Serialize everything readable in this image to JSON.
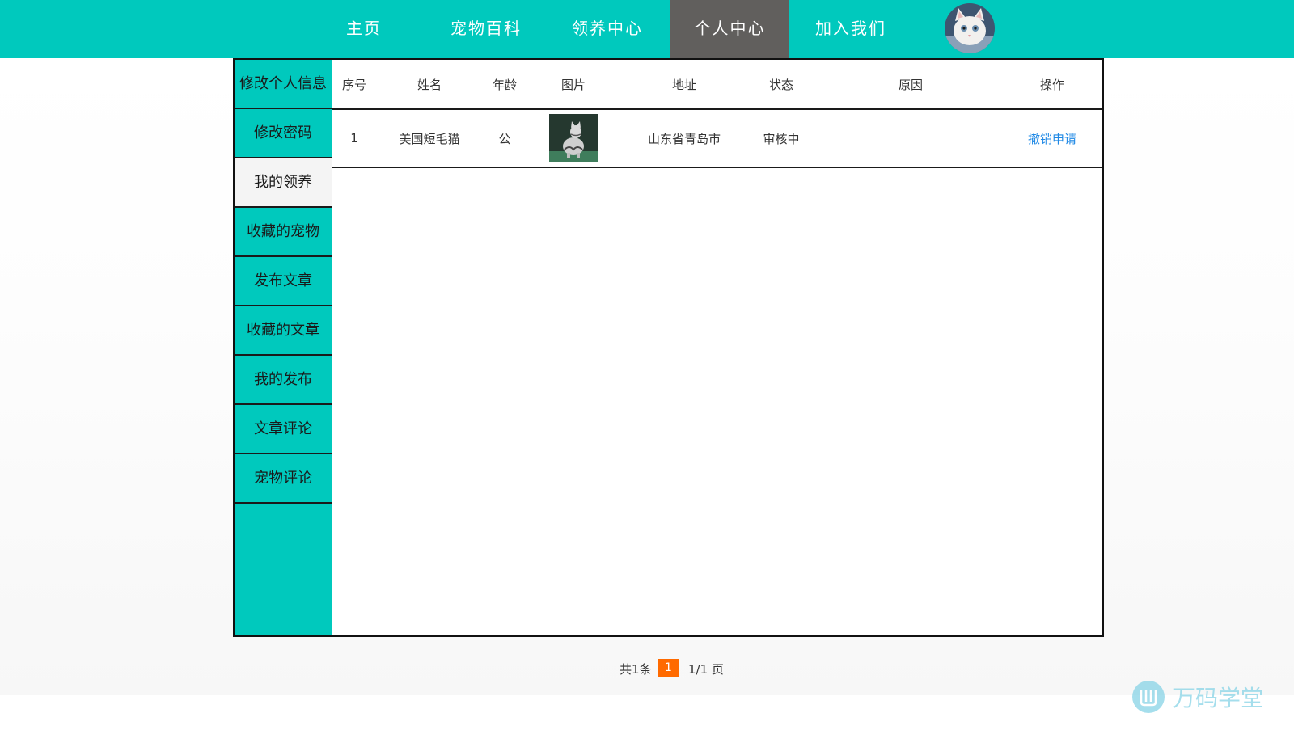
{
  "nav": {
    "items": [
      "主页",
      "宠物百科",
      "领养中心",
      "个人中心",
      "加入我们"
    ],
    "active_index": 3
  },
  "sidebar": {
    "items": [
      "修改个人信息",
      "修改密码",
      "我的领养",
      "收藏的宠物",
      "发布文章",
      "收藏的文章",
      "我的发布",
      "文章评论",
      "宠物评论"
    ],
    "active_index": 2
  },
  "table": {
    "headers": [
      "序号",
      "姓名",
      "年龄",
      "图片",
      "地址",
      "状态",
      "原因",
      "操作"
    ],
    "rows": [
      {
        "index": "1",
        "name": "美国短毛猫",
        "age": "公",
        "image": "cat-photo",
        "address": "山东省青岛市",
        "status": "审核中",
        "reason": "",
        "action": "撤销申请"
      }
    ]
  },
  "pagination": {
    "total": "共1条",
    "current": "1",
    "pages": "1/1 页"
  },
  "watermark": {
    "text": "万码学堂"
  },
  "colors": {
    "primary": "#00c9bd",
    "nav_active": "#615f5d",
    "page_button": "#ff6a00",
    "link": "#1e88e5"
  }
}
